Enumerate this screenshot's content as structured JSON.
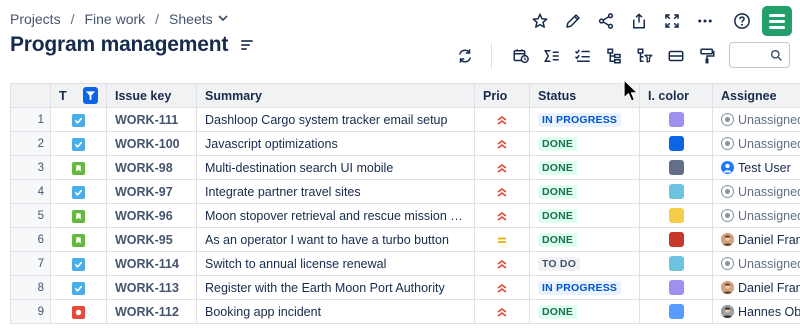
{
  "breadcrumb": {
    "items": [
      "Projects",
      "Fine work",
      "Sheets"
    ],
    "separator": "/"
  },
  "page": {
    "title": "Program management"
  },
  "search": {
    "placeholder": "",
    "value": ""
  },
  "table": {
    "headers": {
      "type": "T",
      "key": "Issue key",
      "summary": "Summary",
      "prio": "Prio",
      "status": "Status",
      "color": "I. color",
      "assignee": "Assignee"
    },
    "rows": [
      {
        "n": "1",
        "type": "task",
        "key": "WORK-111",
        "summary": "Dashloop Cargo system tracker email setup",
        "prio": "high",
        "status": "IN PROGRESS",
        "status_kind": "progress",
        "color": "#9f8fef",
        "assignee": "Unassigned",
        "avatar": "unassigned"
      },
      {
        "n": "2",
        "type": "task",
        "key": "WORK-100",
        "summary": "Javascript optimizations",
        "prio": "high",
        "status": "DONE",
        "status_kind": "done",
        "color": "#0c66e4",
        "assignee": "Unassigned",
        "avatar": "unassigned"
      },
      {
        "n": "3",
        "type": "story",
        "key": "WORK-98",
        "summary": "Multi-destination search UI mobile",
        "prio": "high",
        "status": "DONE",
        "status_kind": "done",
        "color": "#626f86",
        "assignee": "Test User",
        "avatar": "test"
      },
      {
        "n": "4",
        "type": "task",
        "key": "WORK-97",
        "summary": "Integrate partner travel sites",
        "prio": "high",
        "status": "DONE",
        "status_kind": "done",
        "color": "#6cc3e0",
        "assignee": "Unassigned",
        "avatar": "unassigned"
      },
      {
        "n": "5",
        "type": "story",
        "key": "WORK-96",
        "summary": "Moon stopover retrieval and rescue mission testing",
        "prio": "high",
        "status": "DONE",
        "status_kind": "done",
        "color": "#f5cd47",
        "assignee": "Unassigned",
        "avatar": "unassigned"
      },
      {
        "n": "6",
        "type": "story",
        "key": "WORK-95",
        "summary": "As an operator I want to have a turbo button",
        "prio": "medium",
        "status": "DONE",
        "status_kind": "done",
        "color": "#c9372c",
        "assignee": "Daniel Fran",
        "avatar": "photo"
      },
      {
        "n": "7",
        "type": "task",
        "key": "WORK-114",
        "summary": "Switch to annual license renewal",
        "prio": "high",
        "status": "TO DO",
        "status_kind": "todo",
        "color": "#6cc3e0",
        "assignee": "Unassigned",
        "avatar": "unassigned"
      },
      {
        "n": "8",
        "type": "task",
        "key": "WORK-113",
        "summary": "Register with the Earth Moon Port Authority",
        "prio": "high",
        "status": "IN PROGRESS",
        "status_kind": "progress",
        "color": "#9f8fef",
        "assignee": "Daniel Fran",
        "avatar": "photo"
      },
      {
        "n": "9",
        "type": "bug",
        "key": "WORK-112",
        "summary": "Booking app incident",
        "prio": "high",
        "status": "DONE",
        "status_kind": "done",
        "color": "#579dff",
        "assignee": "Hannes Ob",
        "avatar": "photo2"
      }
    ]
  },
  "colors": {
    "task": "#4bade8",
    "story": "#63ba3c",
    "bug": "#e5493a",
    "high": "#e2483d",
    "medium": "#e2b203",
    "progress_bg": "#e9f2ff",
    "progress_fg": "#0055cc",
    "done_bg": "#dcfff1",
    "done_fg": "#216e4e",
    "todo_bg": "#f1f2f4",
    "todo_fg": "#44546f",
    "accent": "#0c66e4",
    "app": "#22a06b"
  }
}
